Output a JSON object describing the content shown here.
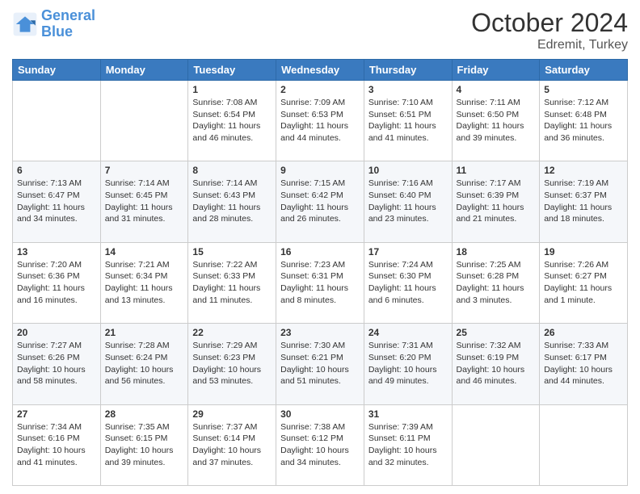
{
  "header": {
    "logo_line1": "General",
    "logo_line2": "Blue",
    "title": "October 2024",
    "subtitle": "Edremit, Turkey"
  },
  "days_of_week": [
    "Sunday",
    "Monday",
    "Tuesday",
    "Wednesday",
    "Thursday",
    "Friday",
    "Saturday"
  ],
  "weeks": [
    [
      {
        "day": "",
        "info": ""
      },
      {
        "day": "",
        "info": ""
      },
      {
        "day": "1",
        "info": "Sunrise: 7:08 AM\nSunset: 6:54 PM\nDaylight: 11 hours and 46 minutes."
      },
      {
        "day": "2",
        "info": "Sunrise: 7:09 AM\nSunset: 6:53 PM\nDaylight: 11 hours and 44 minutes."
      },
      {
        "day": "3",
        "info": "Sunrise: 7:10 AM\nSunset: 6:51 PM\nDaylight: 11 hours and 41 minutes."
      },
      {
        "day": "4",
        "info": "Sunrise: 7:11 AM\nSunset: 6:50 PM\nDaylight: 11 hours and 39 minutes."
      },
      {
        "day": "5",
        "info": "Sunrise: 7:12 AM\nSunset: 6:48 PM\nDaylight: 11 hours and 36 minutes."
      }
    ],
    [
      {
        "day": "6",
        "info": "Sunrise: 7:13 AM\nSunset: 6:47 PM\nDaylight: 11 hours and 34 minutes."
      },
      {
        "day": "7",
        "info": "Sunrise: 7:14 AM\nSunset: 6:45 PM\nDaylight: 11 hours and 31 minutes."
      },
      {
        "day": "8",
        "info": "Sunrise: 7:14 AM\nSunset: 6:43 PM\nDaylight: 11 hours and 28 minutes."
      },
      {
        "day": "9",
        "info": "Sunrise: 7:15 AM\nSunset: 6:42 PM\nDaylight: 11 hours and 26 minutes."
      },
      {
        "day": "10",
        "info": "Sunrise: 7:16 AM\nSunset: 6:40 PM\nDaylight: 11 hours and 23 minutes."
      },
      {
        "day": "11",
        "info": "Sunrise: 7:17 AM\nSunset: 6:39 PM\nDaylight: 11 hours and 21 minutes."
      },
      {
        "day": "12",
        "info": "Sunrise: 7:19 AM\nSunset: 6:37 PM\nDaylight: 11 hours and 18 minutes."
      }
    ],
    [
      {
        "day": "13",
        "info": "Sunrise: 7:20 AM\nSunset: 6:36 PM\nDaylight: 11 hours and 16 minutes."
      },
      {
        "day": "14",
        "info": "Sunrise: 7:21 AM\nSunset: 6:34 PM\nDaylight: 11 hours and 13 minutes."
      },
      {
        "day": "15",
        "info": "Sunrise: 7:22 AM\nSunset: 6:33 PM\nDaylight: 11 hours and 11 minutes."
      },
      {
        "day": "16",
        "info": "Sunrise: 7:23 AM\nSunset: 6:31 PM\nDaylight: 11 hours and 8 minutes."
      },
      {
        "day": "17",
        "info": "Sunrise: 7:24 AM\nSunset: 6:30 PM\nDaylight: 11 hours and 6 minutes."
      },
      {
        "day": "18",
        "info": "Sunrise: 7:25 AM\nSunset: 6:28 PM\nDaylight: 11 hours and 3 minutes."
      },
      {
        "day": "19",
        "info": "Sunrise: 7:26 AM\nSunset: 6:27 PM\nDaylight: 11 hours and 1 minute."
      }
    ],
    [
      {
        "day": "20",
        "info": "Sunrise: 7:27 AM\nSunset: 6:26 PM\nDaylight: 10 hours and 58 minutes."
      },
      {
        "day": "21",
        "info": "Sunrise: 7:28 AM\nSunset: 6:24 PM\nDaylight: 10 hours and 56 minutes."
      },
      {
        "day": "22",
        "info": "Sunrise: 7:29 AM\nSunset: 6:23 PM\nDaylight: 10 hours and 53 minutes."
      },
      {
        "day": "23",
        "info": "Sunrise: 7:30 AM\nSunset: 6:21 PM\nDaylight: 10 hours and 51 minutes."
      },
      {
        "day": "24",
        "info": "Sunrise: 7:31 AM\nSunset: 6:20 PM\nDaylight: 10 hours and 49 minutes."
      },
      {
        "day": "25",
        "info": "Sunrise: 7:32 AM\nSunset: 6:19 PM\nDaylight: 10 hours and 46 minutes."
      },
      {
        "day": "26",
        "info": "Sunrise: 7:33 AM\nSunset: 6:17 PM\nDaylight: 10 hours and 44 minutes."
      }
    ],
    [
      {
        "day": "27",
        "info": "Sunrise: 7:34 AM\nSunset: 6:16 PM\nDaylight: 10 hours and 41 minutes."
      },
      {
        "day": "28",
        "info": "Sunrise: 7:35 AM\nSunset: 6:15 PM\nDaylight: 10 hours and 39 minutes."
      },
      {
        "day": "29",
        "info": "Sunrise: 7:37 AM\nSunset: 6:14 PM\nDaylight: 10 hours and 37 minutes."
      },
      {
        "day": "30",
        "info": "Sunrise: 7:38 AM\nSunset: 6:12 PM\nDaylight: 10 hours and 34 minutes."
      },
      {
        "day": "31",
        "info": "Sunrise: 7:39 AM\nSunset: 6:11 PM\nDaylight: 10 hours and 32 minutes."
      },
      {
        "day": "",
        "info": ""
      },
      {
        "day": "",
        "info": ""
      }
    ]
  ]
}
